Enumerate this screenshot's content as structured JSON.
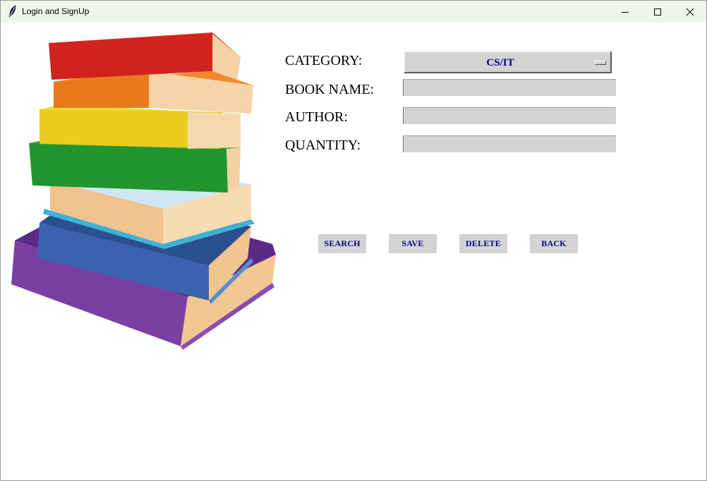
{
  "window": {
    "title": "Login and SignUp",
    "icon": "feather-icon"
  },
  "form": {
    "category_label": "CATEGORY:",
    "category_value": "CS/IT",
    "book_name_label": "BOOK NAME:",
    "book_name_value": "",
    "author_label": "AUTHOR:",
    "author_value": "",
    "quantity_label": "QUANTITY:",
    "quantity_value": ""
  },
  "buttons": {
    "search": "SEARCH",
    "save": "SAVE",
    "delete": "DELETE",
    "back": "BACK"
  },
  "colors": {
    "button_text": "#000080",
    "field_bg": "#d3d3d3",
    "titlebar_bg": "#eef7e7"
  }
}
